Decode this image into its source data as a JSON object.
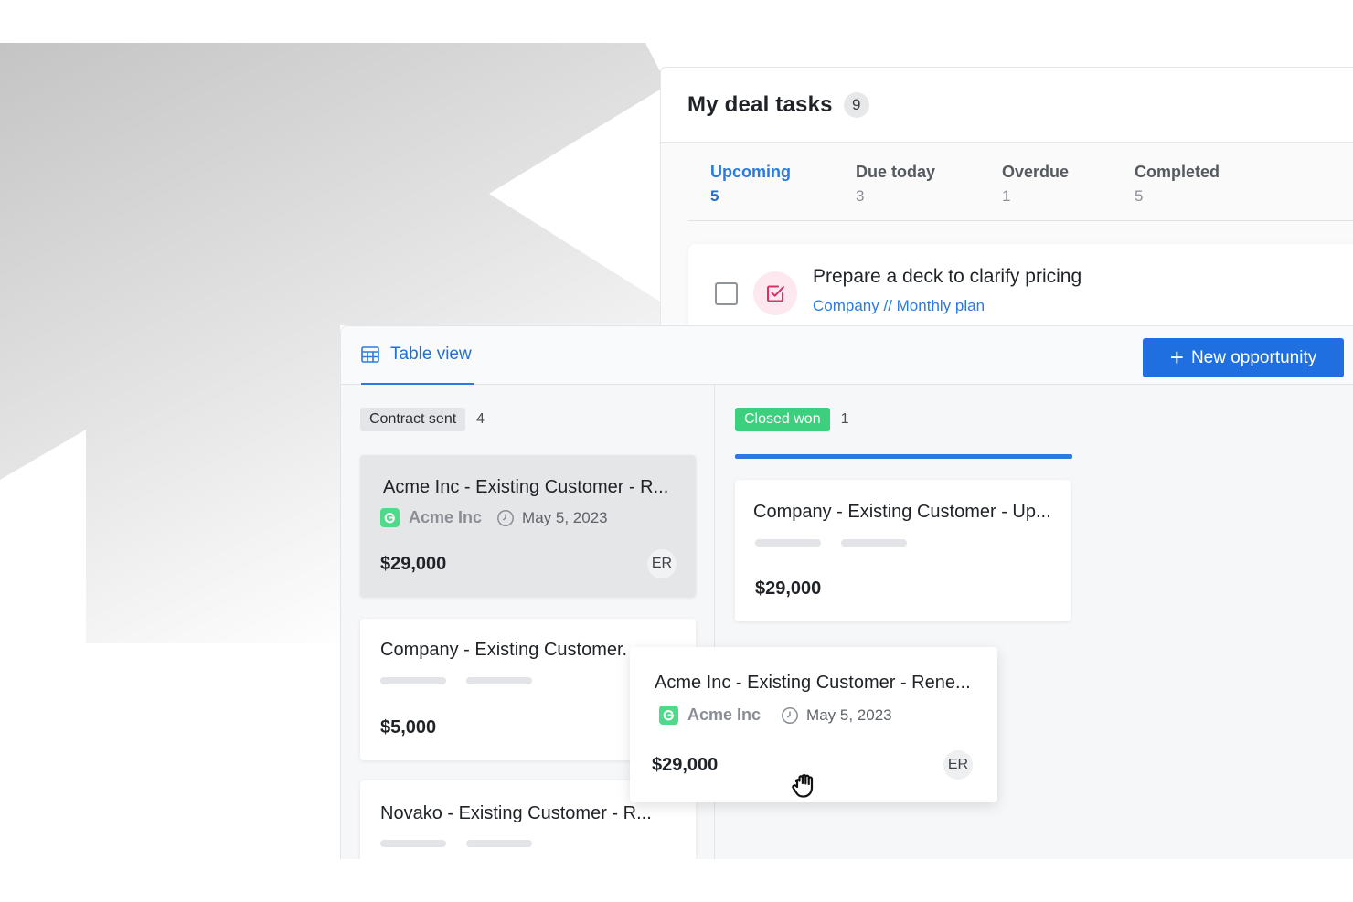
{
  "tasks": {
    "title": "My deal tasks",
    "count": "9",
    "tabs": [
      {
        "label": "Upcoming",
        "count": "5"
      },
      {
        "label": "Due today",
        "count": "3"
      },
      {
        "label": "Overdue",
        "count": "1"
      },
      {
        "label": "Completed",
        "count": "5"
      }
    ],
    "row": {
      "title": "Prepare a deck to clarify pricing",
      "link": "Company // Monthly plan"
    }
  },
  "board": {
    "view_label": "Table view",
    "new_button": "New opportunity",
    "columns": [
      {
        "status": "Contract sent",
        "count": "4",
        "cards": [
          {
            "title": "Acme Inc  - Existing Customer - R...",
            "company": "Acme Inc",
            "date": "May 5, 2023",
            "amount": "$29,000",
            "owner": "ER"
          },
          {
            "title": "Company - Existing Customer.",
            "amount": "$5,000"
          },
          {
            "title": "Novako - Existing Customer - R..."
          }
        ]
      },
      {
        "status": "Closed won",
        "count": "1",
        "cards": [
          {
            "title": "Company - Existing Customer - Up...",
            "amount": "$29,000"
          }
        ]
      }
    ],
    "dragged_card": {
      "title": "Acme Inc - Existing Customer - Rene...",
      "company": "Acme Inc",
      "date": "May 5, 2023",
      "amount": "$29,000",
      "owner": "ER"
    }
  },
  "colors": {
    "accent": "#2a7ae2",
    "success": "#3ccf7d",
    "task_icon": "#e0336f"
  },
  "icons": [
    "table-icon",
    "plus-icon",
    "task-check-icon",
    "clock-icon",
    "company-logo-icon",
    "grab-cursor-icon"
  ]
}
